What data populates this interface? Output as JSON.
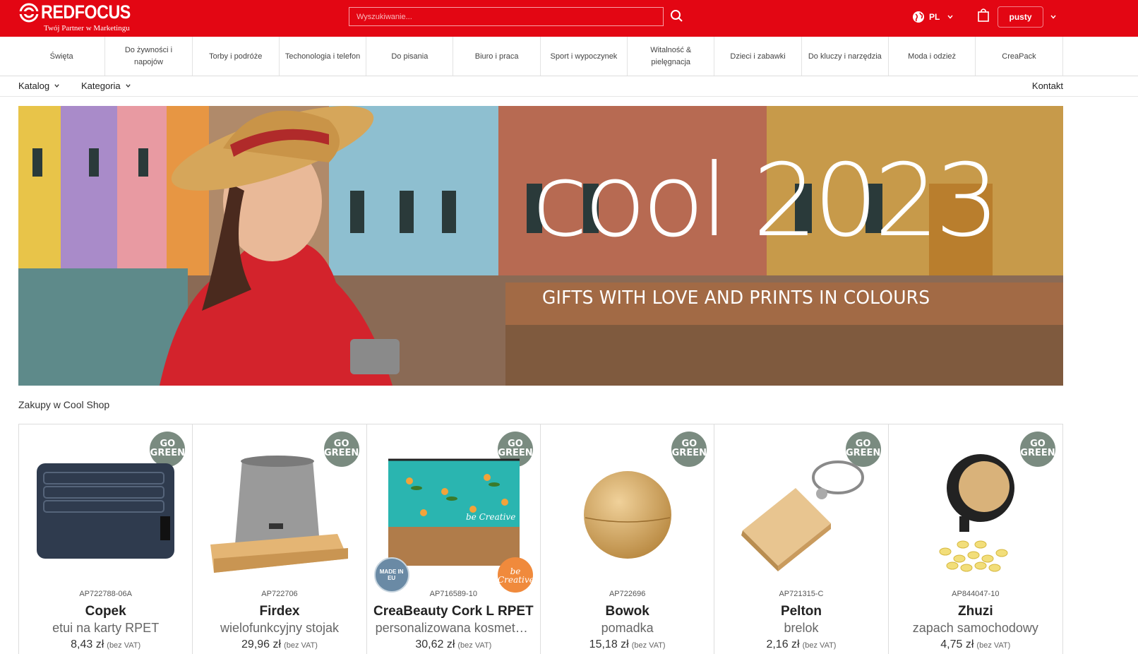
{
  "header": {
    "logo_text": "REDFOCUS",
    "logo_tagline": "Twój Partner w Marketingu",
    "search_placeholder": "Wyszukiwanie...",
    "language": "PL",
    "cart_label": "pusty",
    "brand_color": "#e30613"
  },
  "categories": [
    {
      "label": "Święta"
    },
    {
      "label": "Do żywności i napojów"
    },
    {
      "label": "Torby i podróże"
    },
    {
      "label": "Techonologia i telefon"
    },
    {
      "label": "Do pisania"
    },
    {
      "label": "Biuro i praca"
    },
    {
      "label": "Sport i wypoczynek"
    },
    {
      "label": "Witalność & pielęgnacja"
    },
    {
      "label": "Dzieci i zabawki"
    },
    {
      "label": "Do kluczy i narzędzia"
    },
    {
      "label": "Moda i odzież"
    },
    {
      "label": "CreaPack"
    }
  ],
  "subnav": {
    "catalog": "Katalog",
    "category": "Kategoria",
    "contact": "Kontakt"
  },
  "hero": {
    "title": "cool 2023",
    "subtitle": "GIFTS WITH LOVE AND PRINTS IN COLOURS"
  },
  "section_title": "Zakupy w Cool Shop",
  "products": [
    {
      "sku": "AP722788-06A",
      "name": "Copek",
      "desc": "etui na karty RPET",
      "price": "8,43 zł",
      "vat": "(bez VAT)",
      "badge": "GO GREEN",
      "icon": "card-wallet-image"
    },
    {
      "sku": "AP722706",
      "name": "Firdex",
      "desc": "wielofunkcyjny stojak",
      "price": "29,96 zł",
      "vat": "(bez VAT)",
      "badge": "GO GREEN",
      "icon": "felt-stand-image"
    },
    {
      "sku": "AP716589-10",
      "name": "CreaBeauty Cork L RPET",
      "desc": "personalizowana kosmetyczka",
      "price": "30,62 zł",
      "vat": "(bez VAT)",
      "badge": "GO GREEN",
      "badge_eu": "MADE IN EU",
      "badge_creative": "be Creative",
      "icon": "cosmetic-bag-image"
    },
    {
      "sku": "AP722696",
      "name": "Bowok",
      "desc": "pomadka",
      "price": "15,18 zł",
      "vat": "(bez VAT)",
      "badge": "GO GREEN",
      "icon": "lip-balm-image"
    },
    {
      "sku": "AP721315-C",
      "name": "Pelton",
      "desc": "brelok",
      "price": "2,16 zł",
      "vat": "(bez VAT)",
      "badge": "GO GREEN",
      "icon": "keyring-image"
    },
    {
      "sku": "AP844047-10",
      "name": "Zhuzi",
      "desc": "zapach samochodowy",
      "price": "4,75 zł",
      "vat": "(bez VAT)",
      "badge": "GO GREEN",
      "icon": "car-freshener-image"
    }
  ]
}
